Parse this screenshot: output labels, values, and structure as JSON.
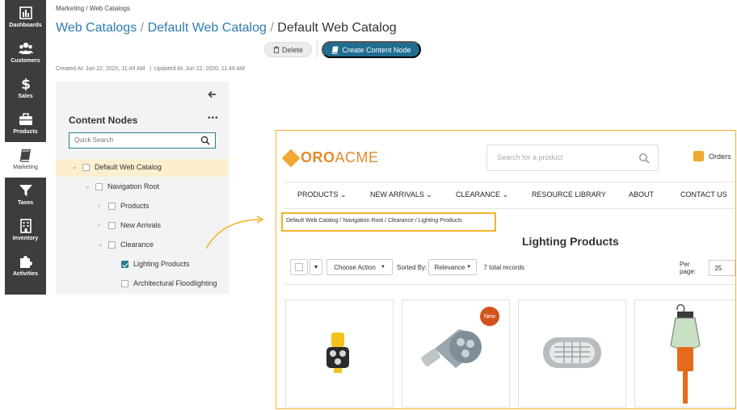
{
  "sidebar": {
    "items": [
      {
        "label": "Dashboards",
        "icon": "bar-chart-icon"
      },
      {
        "label": "Customers",
        "icon": "users-icon"
      },
      {
        "label": "Sales",
        "icon": "dollar-icon"
      },
      {
        "label": "Products",
        "icon": "briefcase-icon"
      },
      {
        "label": "Marketing",
        "icon": "book-icon",
        "active": true
      },
      {
        "label": "Taxes",
        "icon": "filter-icon"
      },
      {
        "label": "Inventory",
        "icon": "building-icon"
      },
      {
        "label": "Activities",
        "icon": "puzzle-icon"
      }
    ]
  },
  "header": {
    "breadcrumb": "Marketing / Web Catalogs",
    "title_link1": "Web Catalogs",
    "title_link2": "Default Web Catalog",
    "title_sep": "/",
    "title_current": "Default Web Catalog",
    "delete_label": "Delete",
    "create_label": "Create Content Node",
    "meta": "Created At: Jun 22, 2020, 11:49 AM   |  Updated At: Jun 22, 2020, 11:49 AM"
  },
  "panel": {
    "title": "Content Nodes",
    "more": "•••",
    "search_placeholder": "Quick Search",
    "tree": [
      {
        "label": "Default Web Catalog",
        "checked": false
      },
      {
        "label": "Navigation Root",
        "checked": false
      },
      {
        "label": "Products",
        "checked": false
      },
      {
        "label": "New Arrivals",
        "checked": false
      },
      {
        "label": "Clearance",
        "checked": false
      },
      {
        "label": "Lighting Products",
        "checked": true
      },
      {
        "label": "Architectural Floodlighting",
        "checked": false
      }
    ]
  },
  "store": {
    "logo_part1": "ORO",
    "logo_part2": "ACME",
    "search_placeholder": "Search for a product",
    "orders_label": "Orders",
    "menu": [
      "PRODUCTS",
      "NEW ARRIVALS",
      "CLEARANCE",
      "RESOURCE LIBRARY",
      "ABOUT",
      "CONTACT US"
    ],
    "breadcrumb": "Default Web Catalog / Navigation Root / Clearance / Lighting Products",
    "heading": "Lighting Products",
    "choose_action": "Choose Action",
    "sorted_by": "Sorted By:",
    "sort_value": "Relevance",
    "total": "7 total records",
    "per_page_label": "Per page:",
    "per_page_value": "25",
    "badge": "New"
  },
  "colors": {
    "accent": "#2f7bb0",
    "primary_button": "#1f6d8f",
    "highlight_frame": "#f0b429",
    "brand_orange": "#e08c2a",
    "selected_row": "#fcefd0"
  }
}
